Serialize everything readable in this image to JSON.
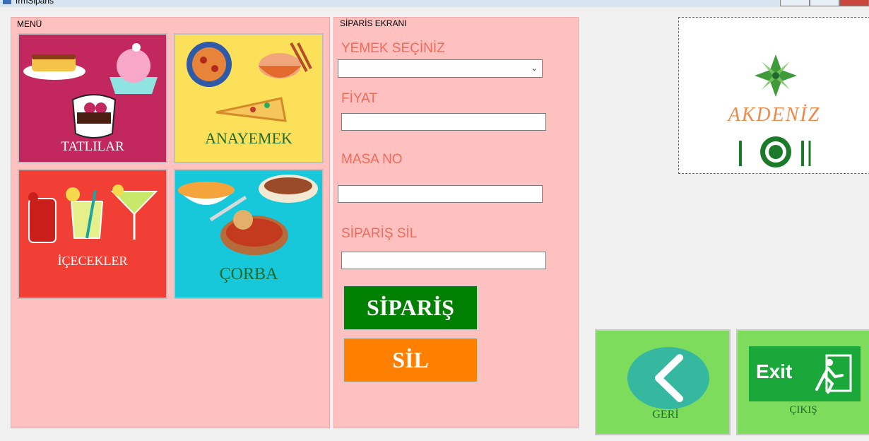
{
  "window": {
    "title": "frmSiparis"
  },
  "menu_group": {
    "label": "MENÜ",
    "tiles": [
      {
        "caption": "TATLILAR",
        "bg": "#c2275e"
      },
      {
        "caption": "ANAYEMEK",
        "bg": "#fde05a"
      },
      {
        "caption": "İÇECEKLER",
        "bg": "#f23f35"
      },
      {
        "caption": "ÇORBA",
        "bg": "#16c8da"
      }
    ]
  },
  "order_group": {
    "label": "SİPARİS EKRANI",
    "food_label": "YEMEK SEÇİNİZ",
    "food_value": "",
    "price_label": "FİYAT",
    "price_value": "",
    "table_label": "MASA NO",
    "table_value": "",
    "delete_label": "SİPARİŞ SİL",
    "delete_value": "",
    "order_button": "SİPARİŞ",
    "delete_button": "SİL",
    "order_button_color": "#008000",
    "delete_button_color": "#ff8000"
  },
  "logo": {
    "text": "AKDENİZ"
  },
  "nav": {
    "back_label": "GERİ",
    "exit_sign": "Exit",
    "exit_label": "ÇIKIŞ",
    "accent": "#7ddc5c"
  }
}
